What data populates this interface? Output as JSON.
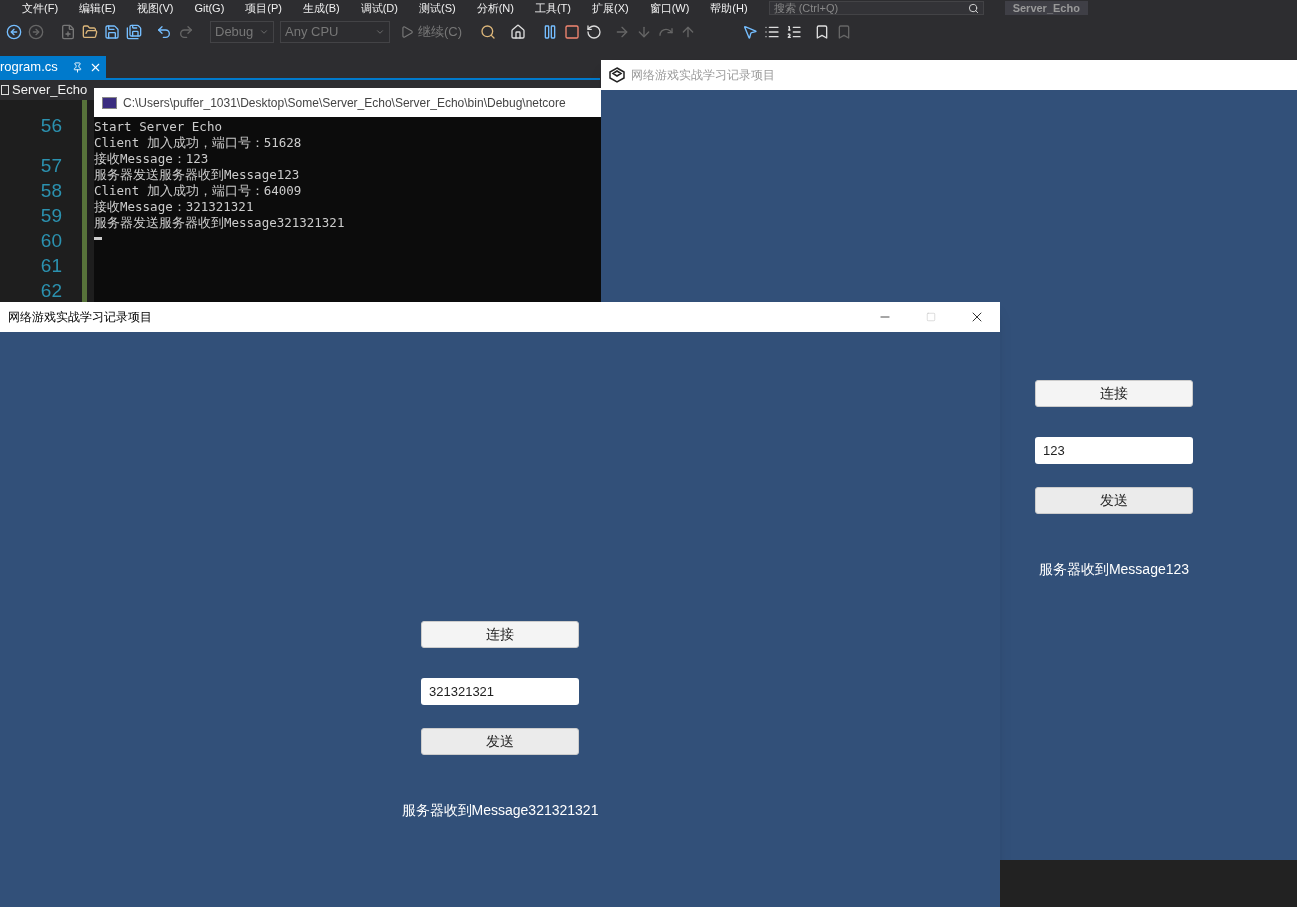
{
  "menu_bar": {
    "items": [
      "文件(F)",
      "编辑(E)",
      "视图(V)",
      "Git(G)",
      "项目(P)",
      "生成(B)",
      "调试(D)",
      "测试(S)",
      "分析(N)",
      "工具(T)",
      "扩展(X)",
      "窗口(W)",
      "帮助(H)"
    ],
    "search": {
      "placeholder": "搜索 (Ctrl+Q)"
    },
    "solution_name": "Server_Echo"
  },
  "toolbar": {
    "configuration": "Debug",
    "platform": "Any CPU",
    "continue_label": "继续(C)"
  },
  "editor": {
    "tab": {
      "label": "rogram.cs",
      "selected": true
    },
    "navigation": "Server_Echo",
    "line_numbers": [
      "56",
      "57",
      "58",
      "59",
      "60",
      "61",
      "62"
    ]
  },
  "console_window": {
    "title": "C:\\Users\\puffer_1031\\Desktop\\Some\\Server_Echo\\Server_Echo\\bin\\Debug\\netcore",
    "lines": [
      "Start Server Echo",
      "Client 加入成功，端口号：51628",
      "接收Message：123",
      "服务器发送服务器收到Message123",
      "Client 加入成功，端口号：64009",
      "接收Message：321321321",
      "服务器发送服务器收到Message321321321"
    ]
  },
  "game_windows": [
    {
      "title": "网络游戏实战学习记录项目",
      "active": false,
      "connect_button": "连接",
      "input_value": "123",
      "send_button": "发送",
      "message": "服务器收到Message123"
    },
    {
      "title": "网络游戏实战学习记录项目",
      "active": true,
      "connect_button": "连接",
      "input_value": "321321321",
      "send_button": "发送",
      "message": "服务器收到Message321321321"
    }
  ]
}
